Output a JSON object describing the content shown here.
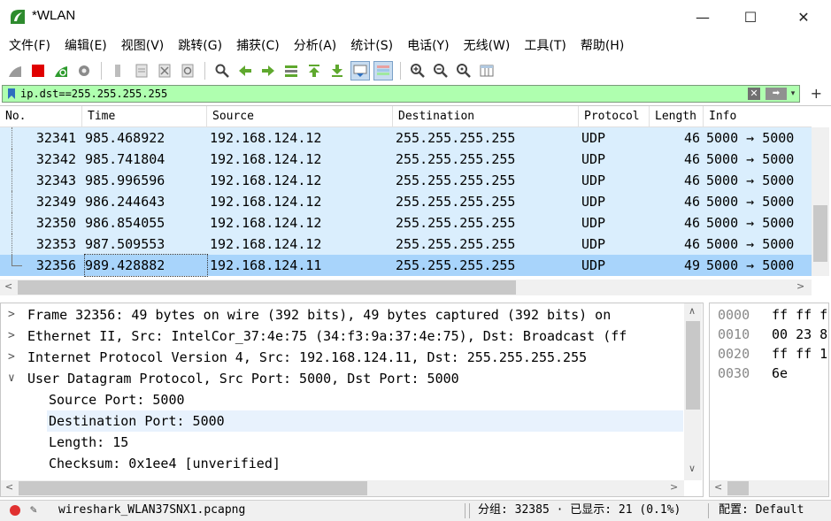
{
  "window": {
    "title": "*WLAN",
    "minimize_glyph": "—",
    "maximize_glyph": "☐",
    "close_glyph": "✕"
  },
  "menu": [
    "文件(F)",
    "编辑(E)",
    "视图(V)",
    "跳转(G)",
    "捕获(C)",
    "分析(A)",
    "统计(S)",
    "电话(Y)",
    "无线(W)",
    "工具(T)",
    "帮助(H)"
  ],
  "toolbar_icons": [
    "shark-fin-start-icon",
    "stop-capture-icon",
    "restart-capture-icon",
    "capture-options-icon",
    "open-file-icon",
    "save-file-icon",
    "close-file-icon",
    "reload-file-icon",
    "find-packet-icon",
    "go-back-icon",
    "go-forward-icon",
    "go-to-packet-icon",
    "go-first-icon",
    "go-last-icon",
    "autoscroll-icon",
    "colorize-icon",
    "zoom-in-icon",
    "zoom-out-icon",
    "zoom-normal-icon",
    "resize-columns-icon"
  ],
  "filter": {
    "value": "ip.dst==255.255.255.255",
    "clear_glyph": "✕",
    "apply_glyph": "➡",
    "dropdown_glyph": "▾",
    "add_glyph": "+"
  },
  "packet_list": {
    "columns": [
      "No.",
      "Time",
      "Source",
      "Destination",
      "Protocol",
      "Length",
      "Info"
    ],
    "rows": [
      {
        "no": "32341",
        "time": "985.468922",
        "source": "192.168.124.12",
        "destination": "255.255.255.255",
        "protocol": "UDP",
        "length": "46",
        "info": "5000 → 5000"
      },
      {
        "no": "32342",
        "time": "985.741804",
        "source": "192.168.124.12",
        "destination": "255.255.255.255",
        "protocol": "UDP",
        "length": "46",
        "info": "5000 → 5000"
      },
      {
        "no": "32343",
        "time": "985.996596",
        "source": "192.168.124.12",
        "destination": "255.255.255.255",
        "protocol": "UDP",
        "length": "46",
        "info": "5000 → 5000"
      },
      {
        "no": "32349",
        "time": "986.244643",
        "source": "192.168.124.12",
        "destination": "255.255.255.255",
        "protocol": "UDP",
        "length": "46",
        "info": "5000 → 5000"
      },
      {
        "no": "32350",
        "time": "986.854055",
        "source": "192.168.124.12",
        "destination": "255.255.255.255",
        "protocol": "UDP",
        "length": "46",
        "info": "5000 → 5000"
      },
      {
        "no": "32353",
        "time": "987.509553",
        "source": "192.168.124.12",
        "destination": "255.255.255.255",
        "protocol": "UDP",
        "length": "46",
        "info": "5000 → 5000"
      },
      {
        "no": "32356",
        "time": "989.428882",
        "source": "192.168.124.11",
        "destination": "255.255.255.255",
        "protocol": "UDP",
        "length": "49",
        "info": "5000 → 5000"
      }
    ]
  },
  "details": {
    "rows": [
      {
        "expander": ">",
        "text": "Frame 32356: 49 bytes on wire (392 bits), 49 bytes captured (392 bits) on"
      },
      {
        "expander": ">",
        "text": "Ethernet II, Src: IntelCor_37:4e:75 (34:f3:9a:37:4e:75), Dst: Broadcast (ff"
      },
      {
        "expander": ">",
        "text": "Internet Protocol Version 4, Src: 192.168.124.11, Dst: 255.255.255.255"
      },
      {
        "expander": "∨",
        "text": "User Datagram Protocol, Src Port: 5000, Dst Port: 5000"
      },
      {
        "expander": "",
        "text": "Source Port: 5000"
      },
      {
        "expander": "",
        "text": "Destination Port: 5000"
      },
      {
        "expander": "",
        "text": "Length: 15"
      },
      {
        "expander": "",
        "text": "Checksum: 0x1ee4 [unverified]"
      }
    ]
  },
  "bytes": {
    "rows": [
      {
        "offset": "0000",
        "hex": "ff ff f"
      },
      {
        "offset": "0010",
        "hex": "00 23 8"
      },
      {
        "offset": "0020",
        "hex": "ff ff 1"
      },
      {
        "offset": "0030",
        "hex": "6e"
      }
    ]
  },
  "status": {
    "file": "wireshark_WLAN37SNX1.pcapng",
    "packets": "分组: 32385 · 已显示: 21 (0.1%)",
    "profile": "配置: Default"
  },
  "colors": {
    "filter_bg": "#afffaf",
    "row_bg": "#daeefd",
    "selected_row_bg": "#a8d4fb",
    "status_dot": "#e03030"
  }
}
